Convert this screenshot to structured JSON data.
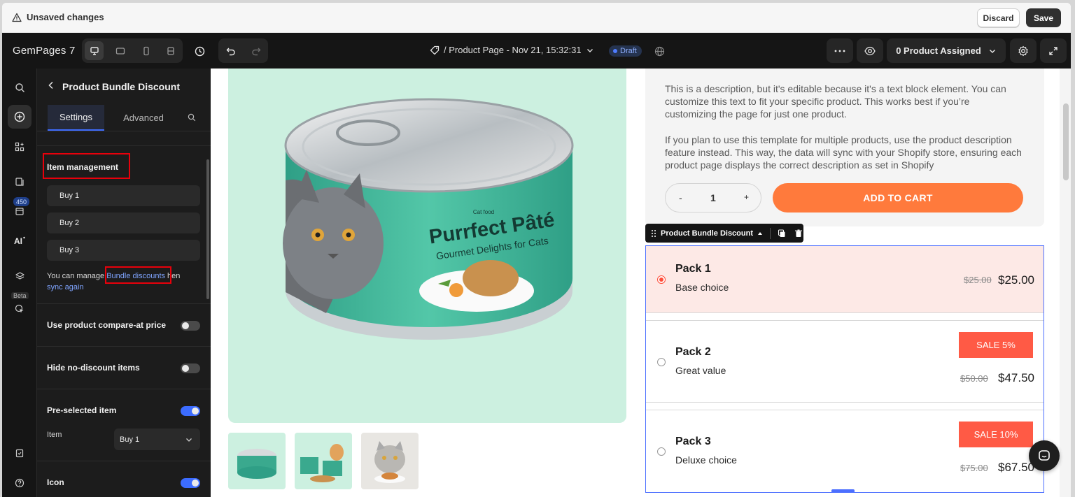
{
  "unsaved_bar": {
    "label": "Unsaved changes",
    "discard_label": "Discard",
    "save_label": "Save"
  },
  "toolbar": {
    "brand": "GemPages 7",
    "page_title": "/ Product Page - Nov 21, 15:32:31",
    "status_badge": "Draft",
    "assigned_label": "0 Product Assigned"
  },
  "rail": {
    "badge_count": "450",
    "beta_label": "Beta"
  },
  "panel": {
    "title": "Product Bundle Discount",
    "tabs": [
      "Settings",
      "Advanced"
    ],
    "item_management_title": "Item management",
    "items": [
      "Buy 1",
      "Buy 2",
      "Buy 3"
    ],
    "note_prefix": "You can manage ",
    "note_link": "Bundle discounts",
    "note_mid": " hen",
    "note_link2": "sync again",
    "settings": [
      {
        "label": "Use product compare-at price",
        "on": false
      },
      {
        "label": "Hide no-discount items",
        "on": false
      },
      {
        "label": "Pre-selected item",
        "on": true
      }
    ],
    "item_select_label": "Item",
    "item_select_value": "Buy 1",
    "icon_label": "Icon",
    "icon_on": true
  },
  "canvas": {
    "description_1": "This is a description, but it's editable because it's a text block element. You can customize this text to fit your specific product. This works best if you’re customizing the page for just one product.",
    "description_2": "If you plan to use this template for multiple products, use the product description feature instead. This way, the data will sync with your Shopify store, ensuring each product page displays the correct description as set in Shopify",
    "qty_minus": "-",
    "qty_value": "1",
    "qty_plus": "+",
    "add_to_cart": "ADD TO CART",
    "element_label": "Product Bundle Discount",
    "product_text": {
      "brand_small": "Cat food",
      "name": "Purrfect Pâté",
      "tagline": "Gourmet Delights for Cats"
    },
    "packs": [
      {
        "name": "Pack 1",
        "subtitle": "Base choice",
        "old_price": "$25.00",
        "price": "$25.00",
        "sale": "",
        "selected": true
      },
      {
        "name": "Pack 2",
        "subtitle": "Great value",
        "old_price": "$50.00",
        "price": "$47.50",
        "sale": "SALE 5%",
        "selected": false
      },
      {
        "name": "Pack 3",
        "subtitle": "Deluxe choice",
        "old_price": "$75.00",
        "price": "$67.50",
        "sale": "SALE 10%",
        "selected": false
      }
    ]
  },
  "colors": {
    "accent": "#3c6cff",
    "add_to_cart": "#ff7a3c",
    "sale_badge": "#ff5a45",
    "hero_bg": "#ccf0e0",
    "highlight": "#e8000b"
  }
}
